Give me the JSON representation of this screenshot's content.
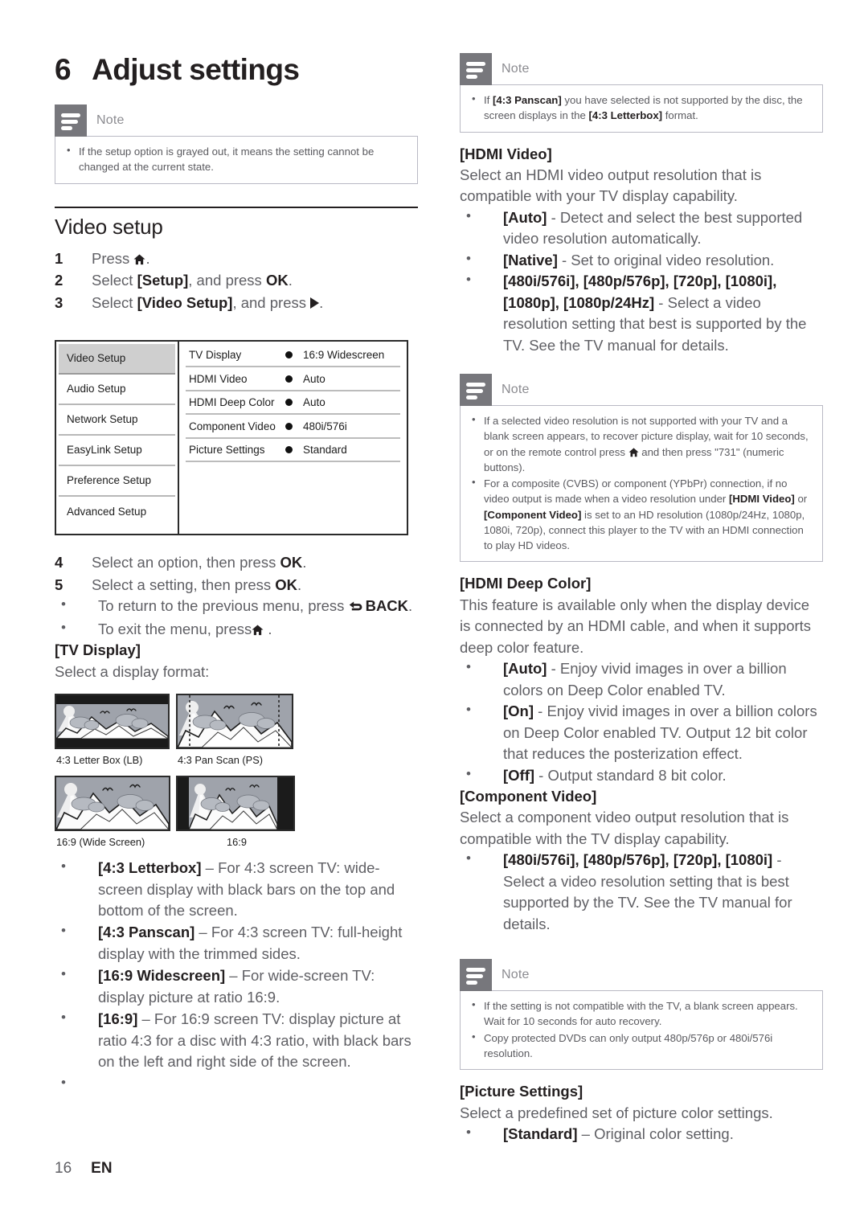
{
  "chapter": {
    "number": "6",
    "title": "Adjust settings"
  },
  "left": {
    "note1": {
      "label": "Note",
      "items": [
        {
          "text": "If the setup option is grayed out, it means the setting cannot be changed at the current state."
        }
      ]
    },
    "section_title": "Video setup",
    "steps": [
      {
        "num": "1",
        "pre": "Press ",
        "icon": "home-icon",
        "post": "."
      },
      {
        "num": "2",
        "pre": "Select ",
        "strong": "[Setup]",
        "mid": ", and press ",
        "strong2": "OK",
        "post": "."
      },
      {
        "num": "3",
        "pre": "Select ",
        "strong": "[Video Setup]",
        "mid": ", and press ",
        "icon": "right-arrow-icon",
        "post": "."
      }
    ],
    "menu": {
      "sidebar": [
        "Video Setup",
        "Audio Setup",
        "Network Setup",
        "EasyLink Setup",
        "Preference Setup",
        "Advanced Setup"
      ],
      "selected_sidebar": "Video Setup",
      "rows": [
        {
          "label": "TV Display",
          "value": "16:9 Widescreen"
        },
        {
          "label": "HDMI Video",
          "value": "Auto"
        },
        {
          "label": "HDMI Deep Color",
          "value": "Auto"
        },
        {
          "label": "Component Video",
          "value": "480i/576i"
        },
        {
          "label": "Picture Settings",
          "value": "Standard"
        }
      ]
    },
    "steps2": [
      {
        "num": "4",
        "pre": "Select an option, then press ",
        "strong": "OK",
        "post": "."
      },
      {
        "num": "5",
        "pre": "Select a setting, then press ",
        "strong": "OK",
        "post": "."
      }
    ],
    "step5_bullets": [
      {
        "pre": "To return to the previous menu, press ",
        "icon": "back-icon",
        "strong": "BACK",
        "post": "."
      },
      {
        "pre": "To exit the menu, press",
        "icon": "home-icon",
        "post": " ."
      }
    ],
    "tv_display_head": "[TV Display]",
    "tv_display_intro": "Select a display format:",
    "tv_figures": [
      {
        "caption": "4:3 Letter Box (LB)",
        "mode": "letterbox"
      },
      {
        "caption": "4:3 Pan Scan (PS)",
        "mode": "panscan"
      },
      {
        "caption": "16:9 (Wide Screen)",
        "mode": "widescreen"
      },
      {
        "caption": "16:9",
        "mode": "pillarbox"
      }
    ],
    "format_bullets": [
      {
        "strong": "[4:3 Letterbox]",
        "text": " – For 4:3 screen TV: wide-screen display with black bars on the top and bottom of the screen."
      },
      {
        "strong": "[4:3 Panscan]",
        "text": " – For 4:3 screen TV: full-height display with the trimmed sides."
      },
      {
        "strong": "[16:9 Widescreen]",
        "text": " – For wide-screen TV: display picture at ratio 16:9."
      },
      {
        "strong": "[16:9]",
        "text": " – For 16:9 screen TV: display picture at ratio 4:3 for a disc with 4:3 ratio, with black bars on the left and right side of the screen."
      },
      {
        "strong": "",
        "text": ""
      }
    ]
  },
  "right": {
    "note1": {
      "label": "Note",
      "items": [
        {
          "pre": "If ",
          "b1": "[4:3 Panscan]",
          "mid": " you have selected is not supported by the disc, the screen displays in the ",
          "b2": "[4:3 Letterbox]",
          "post": " format."
        }
      ]
    },
    "hdmi_video": {
      "head": "[HDMI Video]",
      "intro": "Select an HDMI video output resolution that is compatible with your TV display capability.",
      "bullets": [
        {
          "strong": "[Auto]",
          "text": " - Detect and select the best supported video resolution automatically."
        },
        {
          "strong": "[Native]",
          "text": " - Set to original video resolution."
        },
        {
          "strong": "[480i/576i], [480p/576p], [720p], [1080i], [1080p], [1080p/24Hz]",
          "text": " - Select a video resolution setting that best is supported by the TV. See the TV manual for details."
        }
      ]
    },
    "note2": {
      "label": "Note",
      "items": [
        {
          "pre": "If a selected video resolution is not supported with your TV and a blank screen appears, to recover picture display, wait for 10 seconds, or on the remote control press ",
          "icon": "home-icon",
          "post": " and then press \"731\" (numeric buttons)."
        },
        {
          "pre": "For a composite (CVBS) or component (YPbPr) connection, if no video output is made when a video resolution under ",
          "b1": "[HDMI Video]",
          "mid": " or ",
          "b2": "[Component Video]",
          "post": " is set to an HD resolution (1080p/24Hz, 1080p, 1080i, 720p), connect this player to the TV with an HDMI connection to play HD videos."
        }
      ]
    },
    "hdmi_deep_color": {
      "head": "[HDMI Deep Color]",
      "intro": "This feature is available only when the display device is connected by an HDMI cable, and when it supports deep color feature.",
      "bullets": [
        {
          "strong": "[Auto]",
          "text": " - Enjoy vivid images in over a billion colors on Deep Color enabled TV."
        },
        {
          "strong": "[On]",
          "text": " - Enjoy vivid images in over a billion colors on Deep Color enabled TV. Output 12 bit color that reduces the posterization effect."
        },
        {
          "strong": "[Off]",
          "text": " - Output standard 8 bit color."
        }
      ]
    },
    "component_video": {
      "head": "[Component Video]",
      "intro": "Select a component video output resolution that is compatible with the TV display capability.",
      "bullets": [
        {
          "strong": "[480i/576i], [480p/576p], [720p], [1080i]",
          "text": " - Select a video resolution setting that is best supported by the TV. See the TV manual for details."
        }
      ]
    },
    "note3": {
      "label": "Note",
      "items": [
        {
          "pre": "If the setting is not compatible with the TV, a blank screen appears. Wait for 10 seconds for auto recovery."
        },
        {
          "pre": "Copy protected DVDs can only output 480p/576p or 480i/576i resolution."
        }
      ]
    },
    "picture_settings": {
      "head": "[Picture Settings]",
      "intro": "Select a predefined set of picture color settings.",
      "bullets": [
        {
          "strong": "[Standard]",
          "text": " – Original color setting."
        }
      ]
    }
  },
  "footer": {
    "page": "16",
    "lang": "EN"
  }
}
